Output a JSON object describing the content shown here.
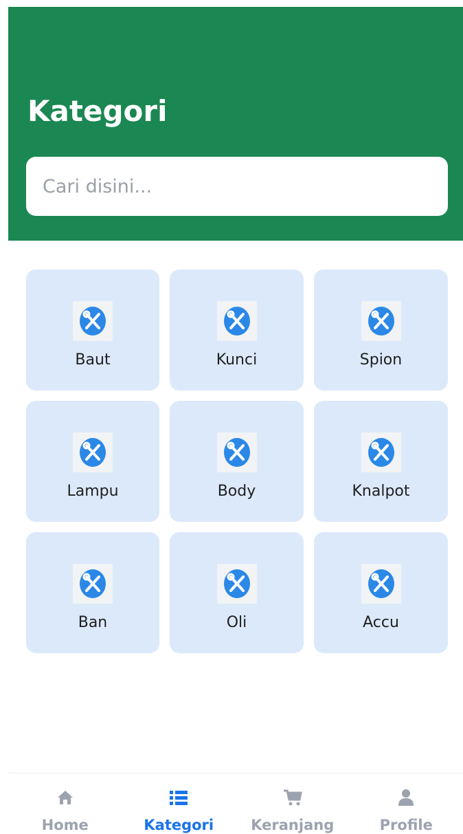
{
  "header": {
    "title": "Kategori",
    "background_color": "#1b8752"
  },
  "search": {
    "placeholder": "Cari disini...",
    "value": ""
  },
  "categories": [
    {
      "label": "Baut",
      "icon": "wrench-screwdriver-icon"
    },
    {
      "label": "Kunci",
      "icon": "wrench-screwdriver-icon"
    },
    {
      "label": "Spion",
      "icon": "wrench-screwdriver-icon"
    },
    {
      "label": "Lampu",
      "icon": "wrench-screwdriver-icon"
    },
    {
      "label": "Body",
      "icon": "wrench-screwdriver-icon"
    },
    {
      "label": "Knalpot",
      "icon": "wrench-screwdriver-icon"
    },
    {
      "label": "Ban",
      "icon": "wrench-screwdriver-icon"
    },
    {
      "label": "Oli",
      "icon": "wrench-screwdriver-icon"
    },
    {
      "label": "Accu",
      "icon": "wrench-screwdriver-icon"
    }
  ],
  "bottom_nav": {
    "items": [
      {
        "label": "Home",
        "icon": "home-icon",
        "active": false
      },
      {
        "label": "Kategori",
        "icon": "list-icon",
        "active": true
      },
      {
        "label": "Keranjang",
        "icon": "cart-icon",
        "active": false
      },
      {
        "label": "Profile",
        "icon": "user-icon",
        "active": false
      }
    ],
    "active_color": "#1a73e8",
    "inactive_color": "#9ca3af"
  },
  "colors": {
    "card_background": "#dce9fb",
    "icon_blue": "#2b88e6"
  }
}
